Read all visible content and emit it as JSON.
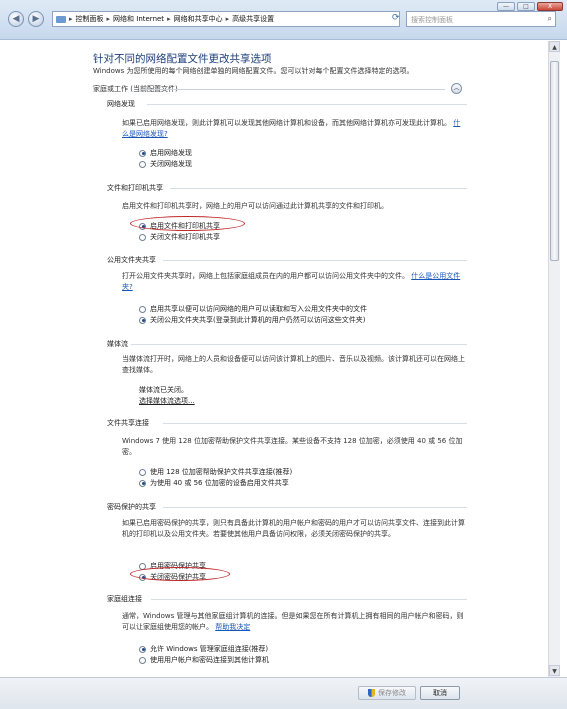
{
  "window": {
    "buttons": {
      "minimize": "—",
      "maximize": "□",
      "close": "X"
    },
    "back": "◀",
    "forward": "▶",
    "breadcrumbs": [
      "控制面板",
      "网络和 Internet",
      "网络和共享中心",
      "高级共享设置"
    ],
    "search_placeholder": "搜索控制面板"
  },
  "page": {
    "title": "针对不同的网络配置文件更改共享选项",
    "description": "Windows 为您所使用的每个网络创建单独的网络配置文件。您可以针对每个配置文件选择特定的选项。",
    "profile": "家庭或工作 (当前配置文件)"
  },
  "sections": {
    "discovery": {
      "title": "网络发现",
      "text": "如果已启用网络发现，则此计算机可以发现其他网络计算机和设备，而其他网络计算机亦可发现此计算机。",
      "link": "什么是网络发现?",
      "options": [
        "启用网络发现",
        "关闭网络发现"
      ],
      "selected": 0
    },
    "file_print": {
      "title": "文件和打印机共享",
      "text": "启用文件和打印机共享时，网络上的用户可以访问通过此计算机共享的文件和打印机。",
      "options": [
        "启用文件和打印机共享",
        "关闭文件和打印机共享"
      ],
      "selected": 0
    },
    "public": {
      "title": "公用文件夹共享",
      "text": "打开公用文件夹共享时，网络上包括家庭组成员在内的用户都可以访问公用文件夹中的文件。",
      "link": "什么是公用文件夹?",
      "options": [
        "启用共享以便可以访问网络的用户可以读取和写入公用文件夹中的文件",
        "关闭公用文件夹共享(登录到此计算机的用户仍然可以访问这些文件夹)"
      ],
      "selected": 1
    },
    "media": {
      "title": "媒体流",
      "text": "当媒体流打开时，网络上的人员和设备便可以访问该计算机上的图片、音乐以及视频。该计算机还可以在网络上查找媒体。",
      "status": "媒体流已关闭。",
      "link": "选择媒体流选项..."
    },
    "connections": {
      "title": "文件共享连接",
      "text": "Windows 7 使用 128 位加密帮助保护文件共享连接。某些设备不支持 128 位加密，必须使用 40 或 56 位加密。",
      "options": [
        "使用 128 位加密帮助保护文件共享连接(推荐)",
        "为使用 40 或 56 位加密的设备启用文件共享"
      ],
      "selected": 1
    },
    "password": {
      "title": "密码保护的共享",
      "text": "如果已启用密码保护的共享，则只有具备此计算机的用户帐户和密码的用户才可以访问共享文件、连接到此计算机的打印机以及公用文件夹。若要使其他用户具备访问权限，必须关闭密码保护的共享。",
      "options": [
        "启用密码保护共享",
        "关闭密码保护共享"
      ],
      "selected": 1
    },
    "homegroup": {
      "title": "家庭组连接",
      "text": "通常，Windows 管理与其他家庭组计算机的连接。但是如果您在所有计算机上拥有相同的用户帐户和密码，则可以让家庭组使用您的帐户。",
      "link": "帮助我决定",
      "options": [
        "允许 Windows 管理家庭组连接(推荐)",
        "使用用户帐户和密码连接到其他计算机"
      ],
      "selected": 0
    }
  },
  "footer": {
    "save": "保存修改",
    "cancel": "取消"
  },
  "colors": {
    "title": "#1c3d7a",
    "link": "#1a56b8",
    "highlight": "#c0282a"
  }
}
